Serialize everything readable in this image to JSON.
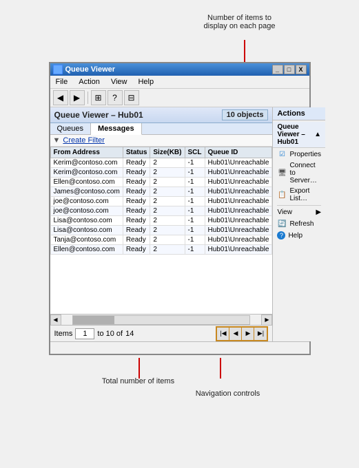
{
  "annotation_top": {
    "text": "Number of items to\ndisplay on each page"
  },
  "window": {
    "title": "Queue Viewer",
    "controls": [
      "_",
      "□",
      "X"
    ]
  },
  "menubar": {
    "items": [
      "File",
      "Action",
      "View",
      "Help"
    ]
  },
  "toolbar": {
    "buttons": [
      "◀",
      "▶",
      "⊞",
      "?",
      "⊟"
    ]
  },
  "panel": {
    "title": "Queue Viewer – Hub01",
    "badge": "10 objects"
  },
  "tabs": {
    "items": [
      "Queues",
      "Messages"
    ],
    "active": "Messages"
  },
  "filter": {
    "label": "Create Filter"
  },
  "table": {
    "columns": [
      "From Address",
      "Status",
      "Size(KB)",
      "SCL",
      "Queue ID"
    ],
    "rows": [
      [
        "Kerim@contoso.com",
        "Ready",
        "2",
        "-1",
        "Hub01\\Unreachable"
      ],
      [
        "Kerim@contoso.com",
        "Ready",
        "2",
        "-1",
        "Hub01\\Unreachable"
      ],
      [
        "Ellen@contoso.com",
        "Ready",
        "2",
        "-1",
        "Hub01\\Unreachable"
      ],
      [
        "James@contoso.com",
        "Ready",
        "2",
        "-1",
        "Hub01\\Unreachable"
      ],
      [
        "joe@contoso.com",
        "Ready",
        "2",
        "-1",
        "Hub01\\Unreachable"
      ],
      [
        "joe@contoso.com",
        "Ready",
        "2",
        "-1",
        "Hub01\\Unreachable"
      ],
      [
        "Lisa@contoso.com",
        "Ready",
        "2",
        "-1",
        "Hub01\\Unreachable"
      ],
      [
        "Lisa@contoso.com",
        "Ready",
        "2",
        "-1",
        "Hub01\\Unreachable"
      ],
      [
        "Tanja@contoso.com",
        "Ready",
        "2",
        "-1",
        "Hub01\\Unreachable"
      ],
      [
        "Ellen@contoso.com",
        "Ready",
        "2",
        "-1",
        "Hub01\\Unreachable"
      ]
    ]
  },
  "pagination": {
    "items_label": "Items",
    "current_page_value": "1",
    "to_text": "to 10 of",
    "total": "14"
  },
  "actions": {
    "header": "Actions",
    "section_title": "Queue Viewer – Hub01",
    "items": [
      {
        "label": "Properties",
        "icon": "☑"
      },
      {
        "label": "Connect to Server…",
        "icon": "🖥"
      },
      {
        "label": "Export List…",
        "icon": "📋"
      },
      {
        "label": "View",
        "icon": "",
        "submenu": true
      },
      {
        "label": "Refresh",
        "icon": "🔄"
      },
      {
        "label": "Help",
        "icon": "?"
      }
    ]
  },
  "annotations_bottom": {
    "total_label": "Total number of items",
    "nav_label": "Navigation controls"
  }
}
